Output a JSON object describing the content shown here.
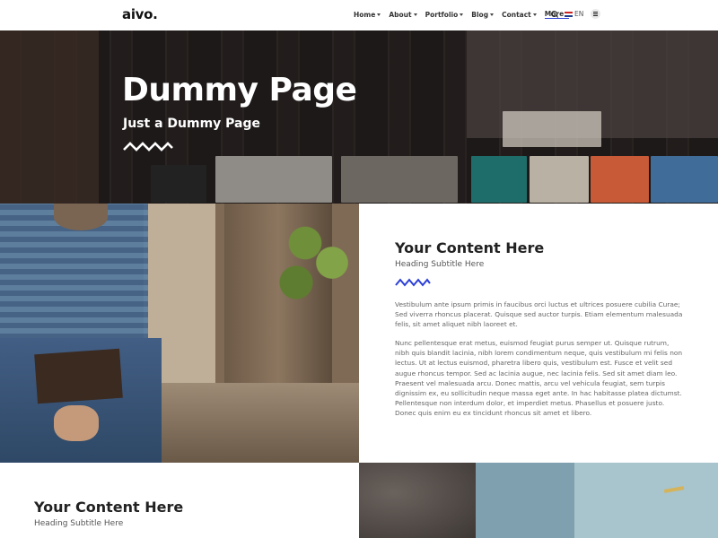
{
  "brand": {
    "logo": "aivo."
  },
  "nav": {
    "items": [
      {
        "label": "Home",
        "has_caret": true
      },
      {
        "label": "About",
        "has_caret": true
      },
      {
        "label": "Portfolio",
        "has_caret": true
      },
      {
        "label": "Blog",
        "has_caret": true
      },
      {
        "label": "Contact",
        "has_caret": true
      },
      {
        "label": "More",
        "has_caret": true,
        "active": true
      }
    ],
    "language": "EN",
    "icons": [
      "search-icon",
      "flag-icon",
      "menu-icon"
    ]
  },
  "hero": {
    "title": "Dummy Page",
    "subtitle": "Just a Dummy Page"
  },
  "section1": {
    "title": "Your Content Here",
    "subtitle": "Heading Subtitle Here",
    "paragraph1": "Vestibulum ante ipsum primis in faucibus orci luctus et ultrices posuere cubilia Curae; Sed viverra rhoncus placerat. Quisque sed auctor turpis. Etiam elementum malesuada felis, sit amet aliquet nibh laoreet et.",
    "paragraph2": "Nunc pellentesque erat metus, euismod feugiat purus semper ut. Quisque rutrum, nibh quis blandit lacinia, nibh lorem condimentum neque, quis vestibulum mi felis non lectus. Ut at lectus euismod, pharetra libero quis, vestibulum est. Fusce et velit sed augue rhoncus tempor. Sed ac lacinia augue, nec lacinia felis. Sed sit amet diam leo. Praesent vel malesuada arcu. Donec mattis, arcu vel vehicula feugiat, sem turpis dignissim ex, eu sollicitudin neque massa eget ante. In hac habitasse platea dictumst. Pellentesque non interdum dolor, et imperdiet metus. Phasellus et posuere justo. Donec quis enim eu ex tincidunt rhoncus sit amet et libero."
  },
  "section2": {
    "title": "Your Content Here",
    "subtitle": "Heading Subtitle Here"
  },
  "colors": {
    "accent": "#2b3fd6",
    "text_dark": "#222222",
    "text_muted": "#666666"
  }
}
